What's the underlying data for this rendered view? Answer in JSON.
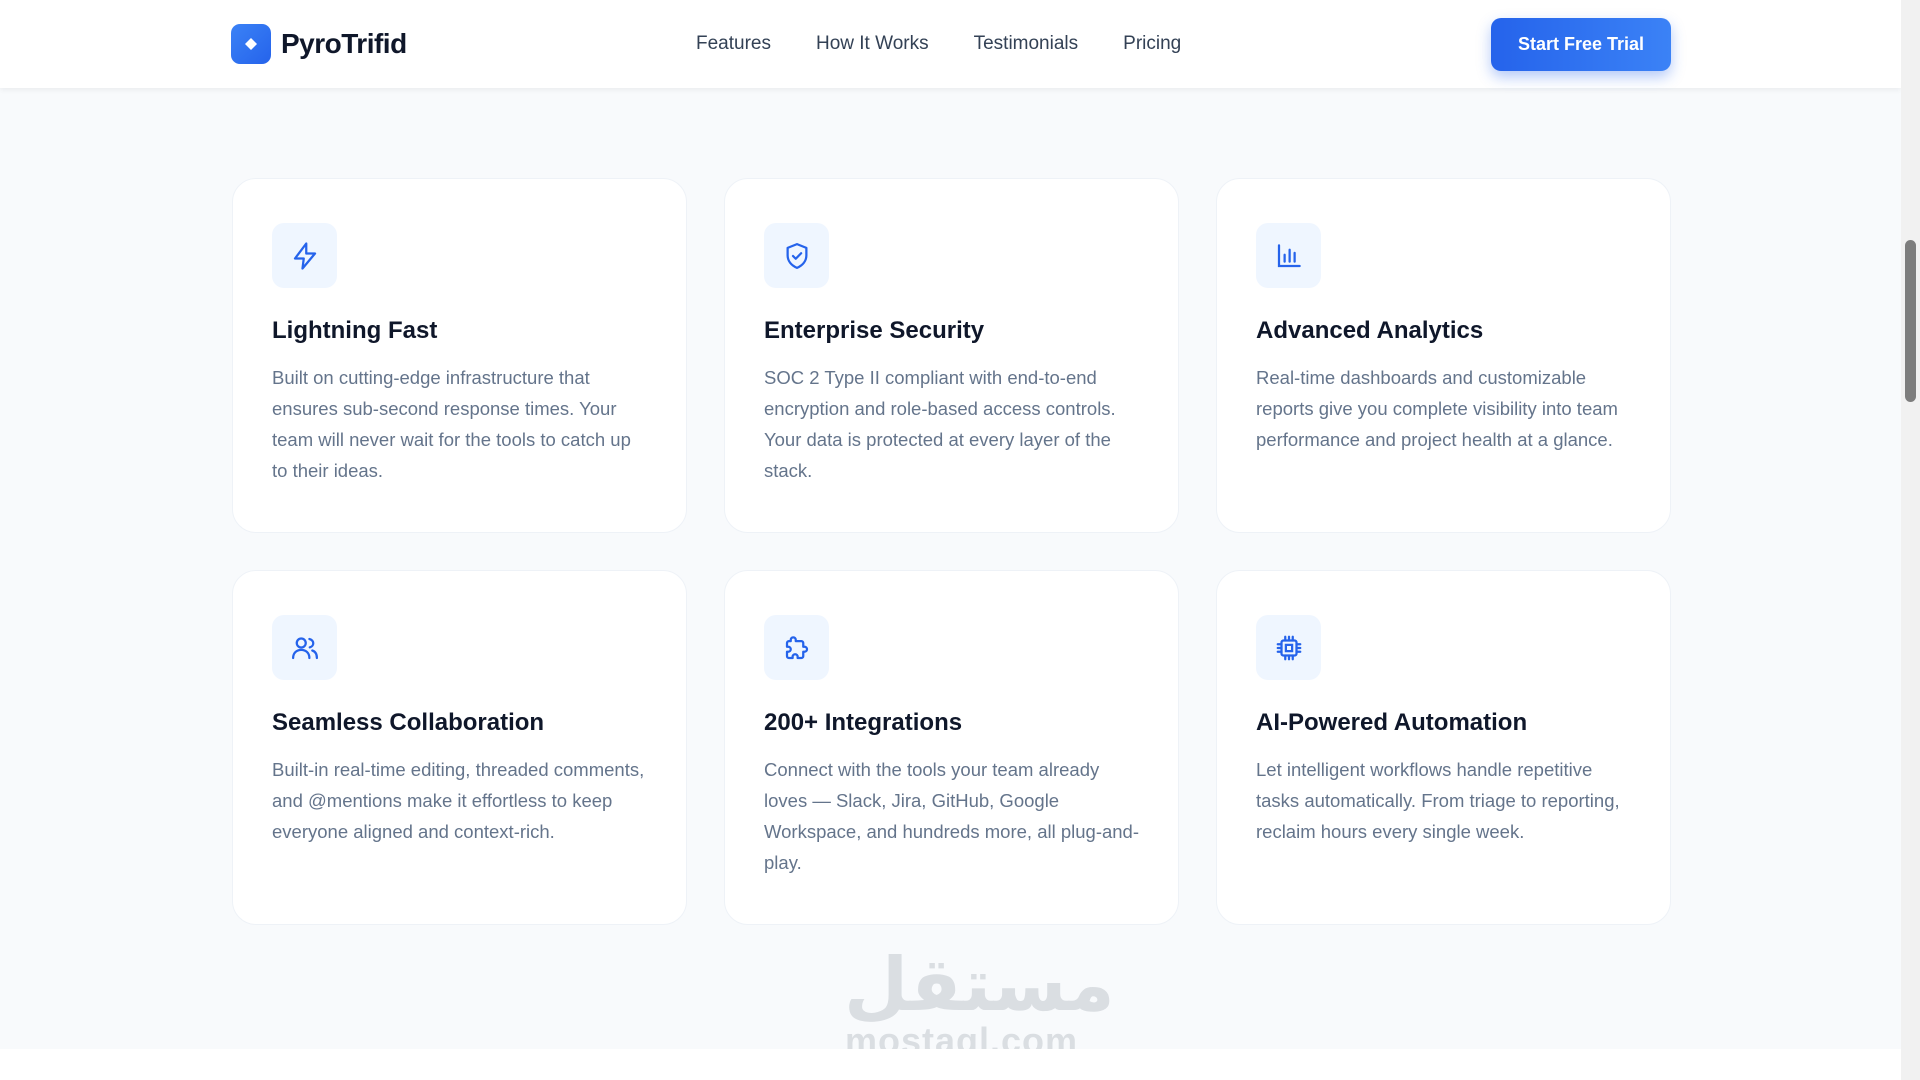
{
  "brand": {
    "name": "PyroTrifid"
  },
  "nav": {
    "links": [
      "Features",
      "How It Works",
      "Testimonials",
      "Pricing"
    ],
    "cta_label": "Start Free Trial"
  },
  "features": [
    {
      "icon": "lightning-icon",
      "title": "Lightning Fast",
      "description": "Built on cutting-edge infrastructure that ensures sub-second response times. Your team will never wait for the tools to catch up to their ideas."
    },
    {
      "icon": "shield-check-icon",
      "title": "Enterprise Security",
      "description": "SOC 2 Type II compliant with end-to-end encryption and role-based access controls. Your data is protected at every layer of the stack."
    },
    {
      "icon": "bar-chart-icon",
      "title": "Advanced Analytics",
      "description": "Real-time dashboards and customizable reports give you complete visibility into team performance and project health at a glance."
    },
    {
      "icon": "users-icon",
      "title": "Seamless Collaboration",
      "description": "Built-in real-time editing, threaded comments, and @mentions make it effortless to keep everyone aligned and context-rich."
    },
    {
      "icon": "puzzle-icon",
      "title": "200+ Integrations",
      "description": "Connect with the tools your team already loves — Slack, Jira, GitHub, Google Workspace, and hundreds more, all plug-and-play."
    },
    {
      "icon": "cpu-chip-icon",
      "title": "AI-Powered Automation",
      "description": "Let intelligent workflows handle repetitive tasks automatically. From triage to reporting, reclaim hours every single week."
    }
  ],
  "watermark": {
    "arabic": "مستقل",
    "latin": "mostaql.com"
  },
  "colors": {
    "accent": "#2563eb",
    "icon_bg": "#eff6ff",
    "heading": "#0f172a",
    "body": "#64748b"
  }
}
